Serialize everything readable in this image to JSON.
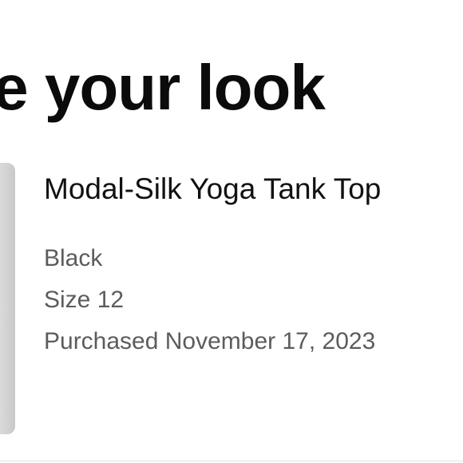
{
  "section": {
    "heading": "ete your look"
  },
  "product": {
    "name": "Modal-Silk Yoga Tank Top",
    "color": "Black",
    "size": "Size 12",
    "purchased": "Purchased November 17, 2023"
  }
}
